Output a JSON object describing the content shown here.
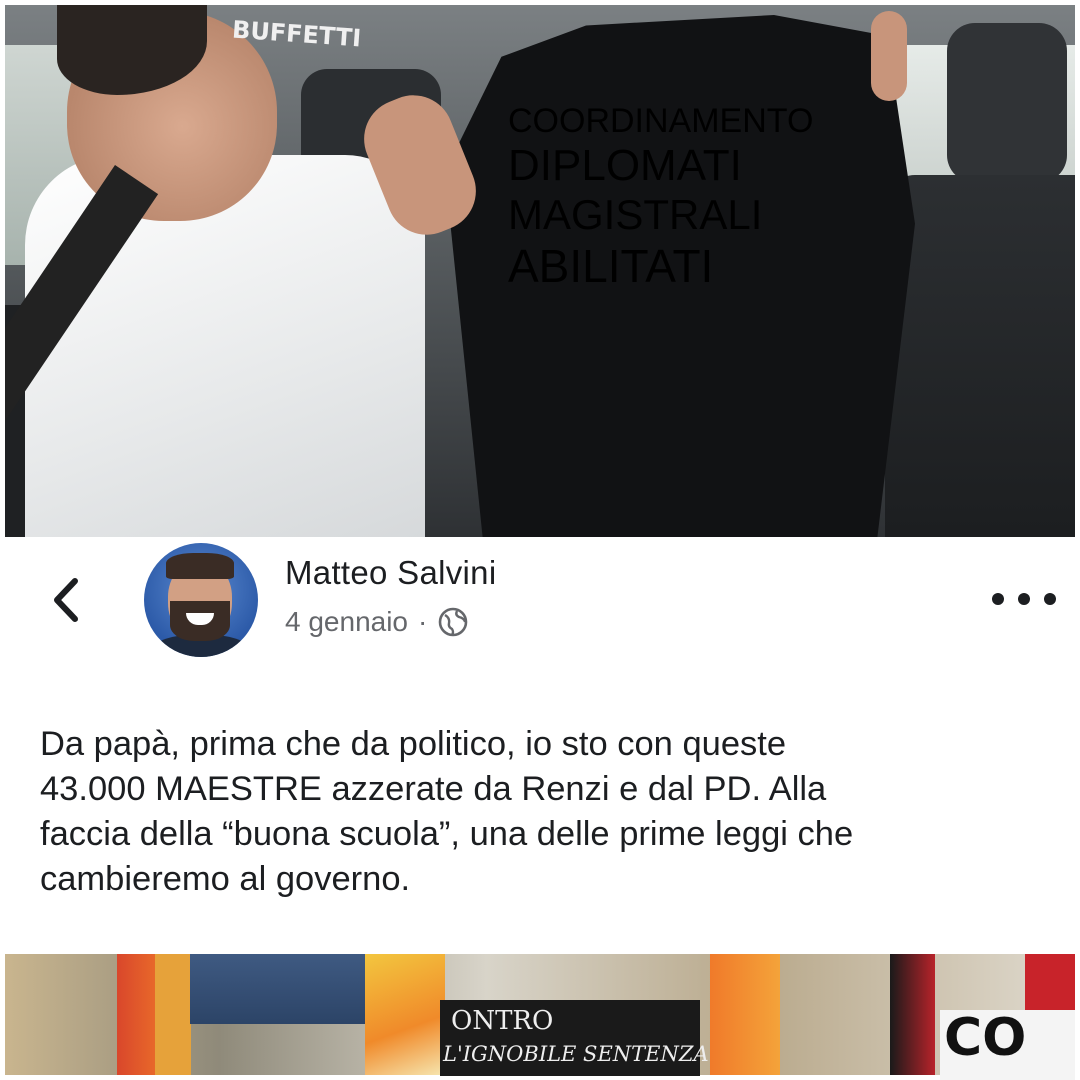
{
  "top_image": {
    "shirt_lines": [
      "COORDINAMENTO",
      "DIPLOMATI",
      "MAGISTRALI",
      "ABILITATI"
    ]
  },
  "post": {
    "author": "Matteo Salvini",
    "date": "4 gennaio",
    "separator": "·",
    "icons": {
      "back": "chevron-left-icon",
      "privacy": "globe-icon",
      "more": "more-options-icon"
    },
    "text_lines": [
      "Da papà, prima che da politico, io sto con queste",
      "43.000 MAESTRE azzerate da Renzi e dal PD. Alla",
      "faccia della “buona scuola”, una delle prime leggi che",
      "cambieremo al governo."
    ]
  },
  "bottom_image": {
    "store_sign": "BUFFETTI",
    "banner_line1": "ONTRO",
    "banner_line2": "L'IGNOBILE SENTENZA",
    "right_sign": "CO"
  },
  "colors": {
    "text_primary": "#1c1e21",
    "text_secondary": "#65676b",
    "background": "#ffffff"
  }
}
